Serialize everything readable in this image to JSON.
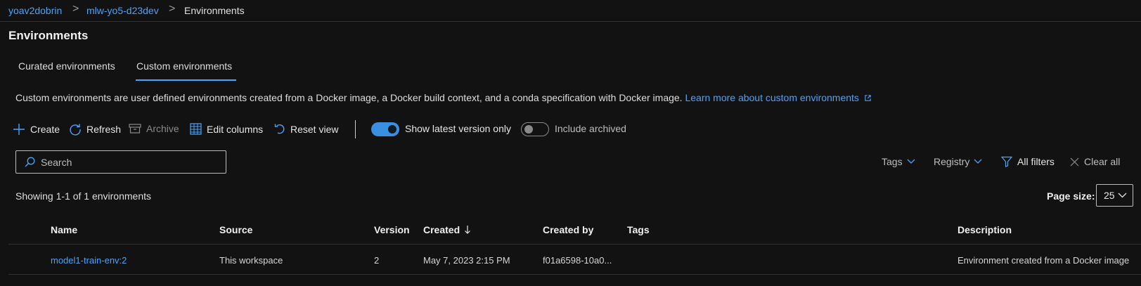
{
  "breadcrumb": {
    "items": [
      "yoav2dobrin",
      "mlw-yo5-d23dev",
      "Environments"
    ],
    "separator": ">"
  },
  "page": {
    "title": "Environments"
  },
  "tabs": [
    {
      "label": "Curated environments",
      "active": false
    },
    {
      "label": "Custom environments",
      "active": true
    }
  ],
  "description": {
    "text": "Custom environments are user defined environments created from a Docker image, a Docker build context, and a conda specification with Docker image.",
    "link": "Learn more about custom environments"
  },
  "toolbar": {
    "create": "Create",
    "refresh": "Refresh",
    "archive": "Archive",
    "edit_columns": "Edit columns",
    "reset_view": "Reset view",
    "latest_toggle": {
      "label": "Show latest version only",
      "on": true
    },
    "archived_toggle": {
      "label": "Include archived",
      "on": false
    }
  },
  "search": {
    "placeholder": "Search",
    "value": ""
  },
  "filters": {
    "tags": "Tags",
    "registry": "Registry",
    "all_filters": "All filters",
    "clear_all": "Clear all"
  },
  "summary": {
    "showing": "Showing 1-1 of 1 environments"
  },
  "page_size": {
    "label": "Page size:",
    "value": "25"
  },
  "table": {
    "headers": {
      "name": "Name",
      "source": "Source",
      "version": "Version",
      "created": "Created",
      "created_by": "Created by",
      "tags": "Tags",
      "description": "Description"
    },
    "rows": [
      {
        "name": "model1-train-env:2",
        "source": "This workspace",
        "version": "2",
        "created": "May 7, 2023 2:15 PM",
        "created_by": "f01a6598-10a0...",
        "tags": "",
        "description": "Environment created from a Docker image"
      }
    ]
  },
  "colors": {
    "background": "#121212",
    "accent": "#4aa3ff",
    "toggle_on": "#3b8fe0",
    "text": "#e6e6e6",
    "muted": "#8a8a8a",
    "divider": "#2e2e2e"
  }
}
